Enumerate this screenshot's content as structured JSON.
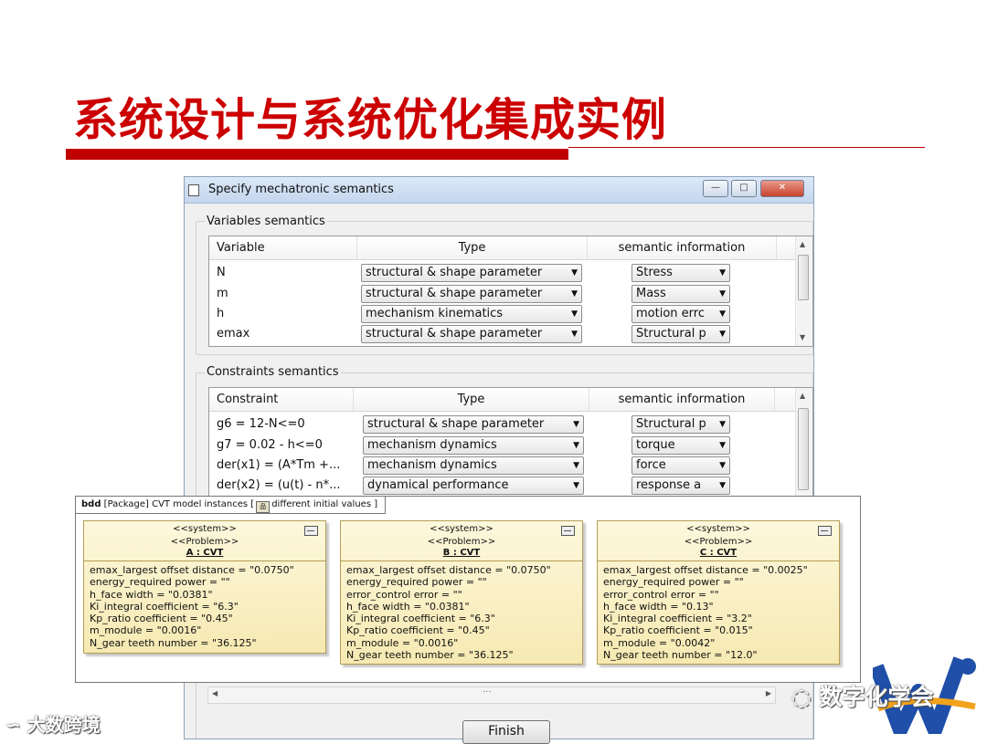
{
  "slide": {
    "title": "系统设计与系统优化集成实例",
    "colors": {
      "title": "#cc0000",
      "bar": "#c00000"
    }
  },
  "dialog": {
    "title": "Specify mechatronic semantics",
    "buttons": {
      "minimize": "—",
      "maximize": "□",
      "close": "✕"
    },
    "variables": {
      "group_label": "Variables semantics",
      "headers": [
        "Variable",
        "Type",
        "semantic information"
      ],
      "rows": [
        {
          "name": "N",
          "type": "structural & shape parameter",
          "info": "Stress"
        },
        {
          "name": "m",
          "type": "structural & shape parameter",
          "info": "Mass"
        },
        {
          "name": "h",
          "type": "mechanism kinematics",
          "info": "motion errc"
        },
        {
          "name": "emax",
          "type": "structural & shape parameter",
          "info": "Structural p"
        }
      ]
    },
    "constraints": {
      "group_label": "Constraints semantics",
      "headers": [
        "Constraint",
        "Type",
        "semantic information"
      ],
      "rows": [
        {
          "name": "g6 = 12-N<=0",
          "type": "structural & shape parameter",
          "info": "Structural p"
        },
        {
          "name": "g7 = 0.02 - h<=0",
          "type": "mechanism dynamics",
          "info": "torque"
        },
        {
          "name": "der(x1) = (A*Tm +...",
          "type": "mechanism dynamics",
          "info": "force"
        },
        {
          "name": "der(x2) = (u(t) - n*...",
          "type": "dynamical performance",
          "info": "response a"
        }
      ]
    },
    "hscroll_glyph": "···",
    "finish_label": "Finish"
  },
  "bdd": {
    "kind": "bdd",
    "tab_text": "[Package] CVT model instances [",
    "tab_suffix": "different initial values ]",
    "blocks": [
      {
        "stereotype1": "<<system>>",
        "stereotype2": "<<Problem>>",
        "name": "A : CVT",
        "attributes": [
          "emax_largest offset distance = \"0.0750\"",
          "energy_required power = \"\"",
          "h_face width = \"0.0381\"",
          "Ki_integral coefficient = \"6.3\"",
          "Kp_ratio coefficient = \"0.45\"",
          "m_module = \"0.0016\"",
          "N_gear teeth number = \"36.125\""
        ]
      },
      {
        "stereotype1": "<<system>>",
        "stereotype2": "<<Problem>>",
        "name": "B : CVT",
        "attributes": [
          "emax_largest offset distance = \"0.0750\"",
          "energy_required power = \"\"",
          "error_control error = \"\"",
          "h_face width = \"0.0381\"",
          "Ki_integral coefficient = \"6.3\"",
          "Kp_ratio coefficient = \"0.45\"",
          "m_module = \"0.0016\"",
          "N_gear teeth number = \"36.125\""
        ]
      },
      {
        "stereotype1": "<<system>>",
        "stereotype2": "<<Problem>>",
        "name": "C : CVT",
        "attributes": [
          "emax_largest offset distance = \"0.0025\"",
          "energy_required power = \"\"",
          "error_control error = \"\"",
          "h_face width = \"0.13\"",
          "Ki_integral coefficient = \"3.2\"",
          "Kp_ratio coefficient = \"0.015\"",
          "m_module = \"0.0042\"",
          "N_gear teeth number = \"12.0\""
        ]
      }
    ]
  },
  "watermarks": {
    "left": "大数跨境",
    "right": "数字化学会"
  }
}
